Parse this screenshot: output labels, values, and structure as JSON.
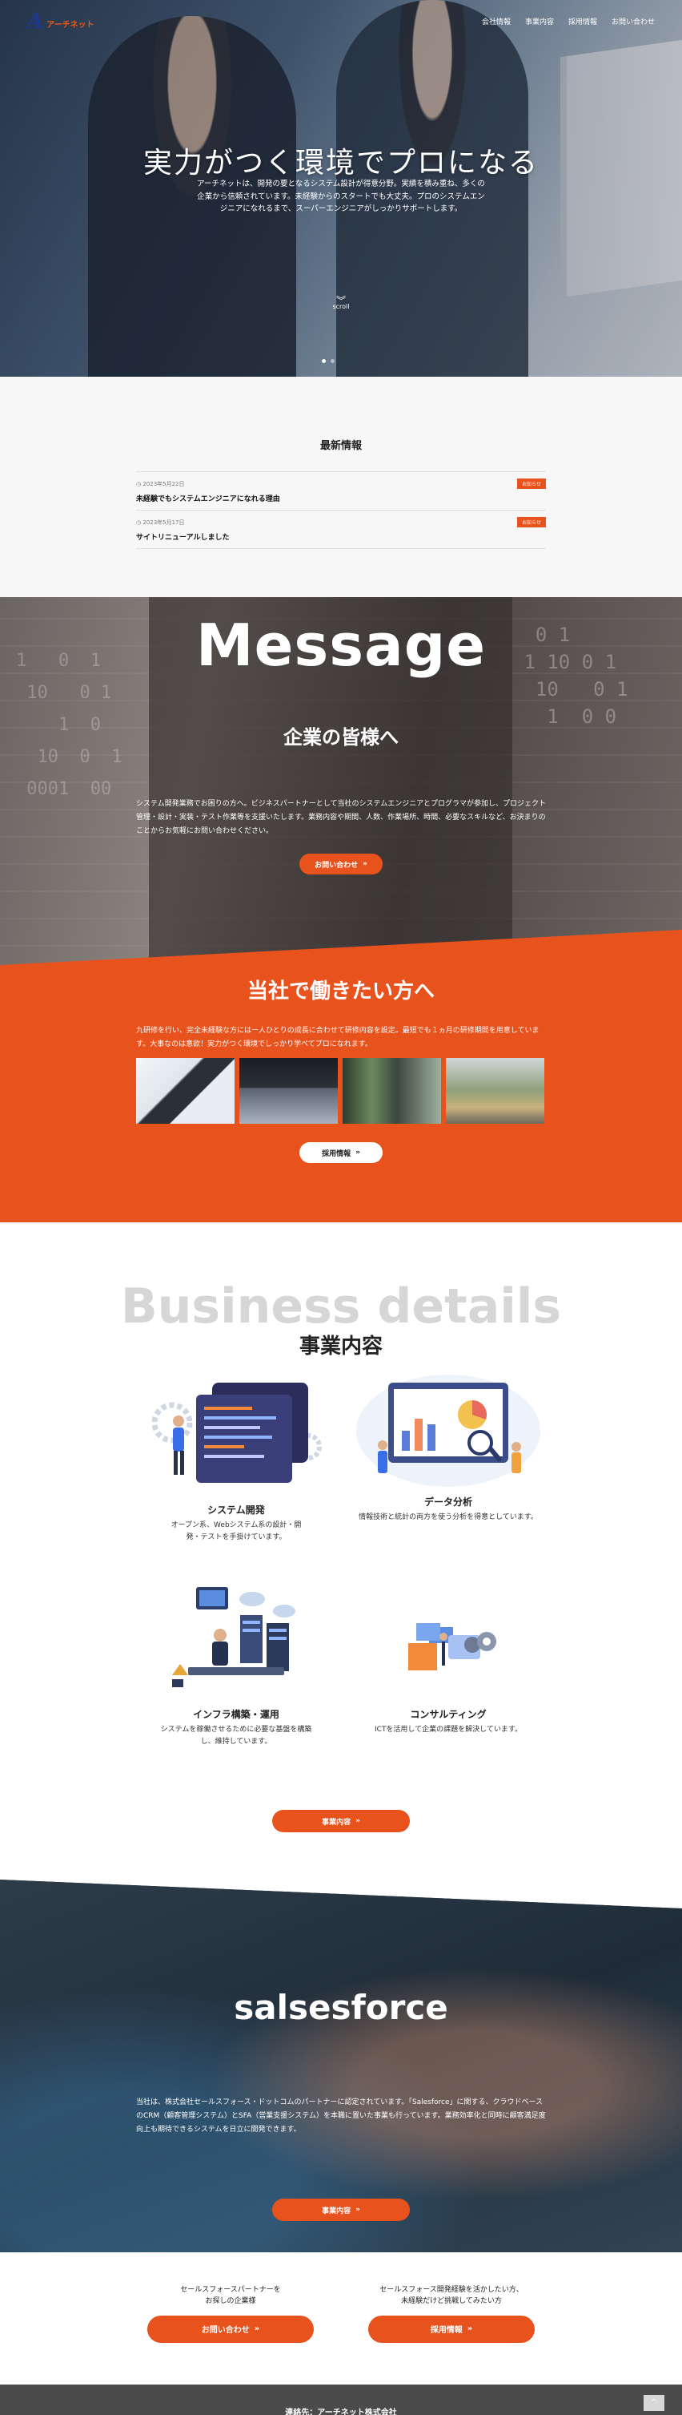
{
  "header": {
    "logo_mark": "A",
    "logo_text": "アーチネット",
    "nav": [
      "会社情報",
      "事業内容",
      "採用情報",
      "お問い合わせ"
    ]
  },
  "hero": {
    "title": "実力がつく環境でプロになる",
    "lead": "アーチネットは、開発の要となるシステム設計が得意分野。実績を積み重ね、多くの企業から信頼されています。未経験からのスタートでも大丈夫。プロのシステムエンジニアになれるまで、スーパーエンジニアがしっかりサポートします。",
    "scroll_label": "scroll"
  },
  "news": {
    "heading": "最新情報",
    "items": [
      {
        "date": "◷ 2023年5月22日",
        "title": "未経験でもシステムエンジニアになれる理由",
        "badge": "お知らせ"
      },
      {
        "date": "◷ 2023年5月17日",
        "title": "サイトリニューアルしました",
        "badge": "お知らせ"
      }
    ]
  },
  "message": {
    "title_en": "Message",
    "title_ja": "企業の皆様へ",
    "body": "システム開発業務でお困りの方へ。ビジネスパートナーとして当社のシステムエンジニアとプログラマが参加し、プロジェクト管理・設計・実装・テスト作業等を支援いたします。業務内容や期間、人数、作業場所、時間、必要なスキルなど、お決まりのことからお気軽にお問い合わせください。",
    "button": "お問い合わせ"
  },
  "recruit": {
    "title": "当社で働きたい方へ",
    "body": "九研修を行い、完全未経験な方にはー人ひとりの成長に合わせて研修内容を設定。最短でも１ヵ月の研修期間を用意しています。大事なのは意欲！実力がつく環境でしっかり学べてプロになれます。",
    "button": "採用情報"
  },
  "business": {
    "title_en": "Business details",
    "title_ja": "事業内容",
    "services": [
      {
        "name": "システム開発",
        "desc": "オープン系、Webシステム系の設計・開発・テストを手掛けています。"
      },
      {
        "name": "データ分析",
        "desc": "情報技術と統計の両方を使う分析を得意としています。"
      },
      {
        "name": "インフラ構築・運用",
        "desc": "システムを稼働させるために必要な基盤を構築し、維持しています。"
      },
      {
        "name": "コンサルティング",
        "desc": "ICTを活用して企業の課題を解決しています。"
      }
    ],
    "button": "事業内容"
  },
  "salesforce": {
    "title": "salsesforce",
    "body": "当社は、株式会社セールスフォース・ドットコムのパートナーに認定されています。「Salesforce」に関する、クラウドベースのCRM（顧客管理システム）とSFA（営業支援システム）を本職に置いた事業も行っています。業務効率化と同時に顧客満足度向上も期待できるシステムを日立に開発できます。",
    "button": "事業内容"
  },
  "cta": {
    "left_text": "セールスフォースパートナーを\nお探しの企業様",
    "left_button": "お問い合わせ",
    "right_text": "セールスフォース開発経験を活かしたい方、\n未経験だけど挑戦してみたい方",
    "right_button": "採用情報"
  },
  "footer": {
    "text": "連絡先：アーチネット株式会社",
    "pagetop": "^"
  },
  "colors": {
    "accent": "#e8521d",
    "logo": "#1e3a8c"
  }
}
